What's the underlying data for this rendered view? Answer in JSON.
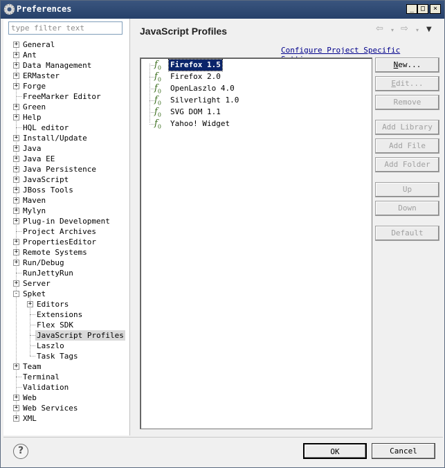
{
  "window": {
    "title": "Preferences",
    "min_label": "_",
    "max_label": "□",
    "close_label": "×"
  },
  "filter": {
    "placeholder": "type filter text"
  },
  "tree": {
    "items": [
      {
        "label": "General",
        "expander": "+"
      },
      {
        "label": "Ant",
        "expander": "+"
      },
      {
        "label": "Data Management",
        "expander": "+"
      },
      {
        "label": "ERMaster",
        "expander": "+"
      },
      {
        "label": "Forge",
        "expander": "+"
      },
      {
        "label": "FreeMarker Editor",
        "expander": ""
      },
      {
        "label": "Green",
        "expander": "+"
      },
      {
        "label": "Help",
        "expander": "+"
      },
      {
        "label": "HQL editor",
        "expander": ""
      },
      {
        "label": "Install/Update",
        "expander": "+"
      },
      {
        "label": "Java",
        "expander": "+"
      },
      {
        "label": "Java EE",
        "expander": "+"
      },
      {
        "label": "Java Persistence",
        "expander": "+"
      },
      {
        "label": "JavaScript",
        "expander": "+"
      },
      {
        "label": "JBoss Tools",
        "expander": "+"
      },
      {
        "label": "Maven",
        "expander": "+"
      },
      {
        "label": "Mylyn",
        "expander": "+"
      },
      {
        "label": "Plug-in Development",
        "expander": "+"
      },
      {
        "label": "Project Archives",
        "expander": ""
      },
      {
        "label": "PropertiesEditor",
        "expander": "+"
      },
      {
        "label": "Remote Systems",
        "expander": "+"
      },
      {
        "label": "Run/Debug",
        "expander": "+"
      },
      {
        "label": "RunJettyRun",
        "expander": ""
      },
      {
        "label": "Server",
        "expander": "+"
      },
      {
        "label": "Spket",
        "expander": "-"
      },
      {
        "label": "Editors",
        "expander": "+"
      },
      {
        "label": "Extensions",
        "expander": ""
      },
      {
        "label": "Flex SDK",
        "expander": ""
      },
      {
        "label": "JavaScript Profiles",
        "expander": ""
      },
      {
        "label": "Laszlo",
        "expander": ""
      },
      {
        "label": "Task Tags",
        "expander": ""
      },
      {
        "label": "Team",
        "expander": "+"
      },
      {
        "label": "Terminal",
        "expander": ""
      },
      {
        "label": "Validation",
        "expander": ""
      },
      {
        "label": "Web",
        "expander": "+"
      },
      {
        "label": "Web Services",
        "expander": "+"
      },
      {
        "label": "XML",
        "expander": "+"
      }
    ]
  },
  "page": {
    "title": "JavaScript Profiles",
    "config_link": "Configure Project Specific Settings...",
    "profiles": [
      "Firefox 1.5",
      "Firefox 2.0",
      "OpenLaszlo 4.0",
      "Silverlight 1.0",
      "SVG DOM 1.1",
      "Yahoo! Widget"
    ],
    "profile_icon_letter": "f",
    "profile_icon_sub": "0"
  },
  "buttons": {
    "new": "New...",
    "edit": "Edit...",
    "remove": "Remove",
    "add_library": "Add Library",
    "add_file": "Add File",
    "add_folder": "Add Folder",
    "up": "Up",
    "down": "Down",
    "default": "Default"
  },
  "nav": {
    "back": "⇦",
    "forward": "⇨",
    "dropdown": "▾",
    "menu": "▼"
  },
  "footer": {
    "help": "?",
    "ok": "OK",
    "cancel": "Cancel"
  },
  "colors": {
    "titlebar": "#26406a",
    "selection": "#0a246a",
    "link": "#00008b"
  },
  "icons": [
    "preferences-icon",
    "function-icon",
    "help-icon",
    "back-arrow-icon",
    "forward-arrow-icon"
  ]
}
